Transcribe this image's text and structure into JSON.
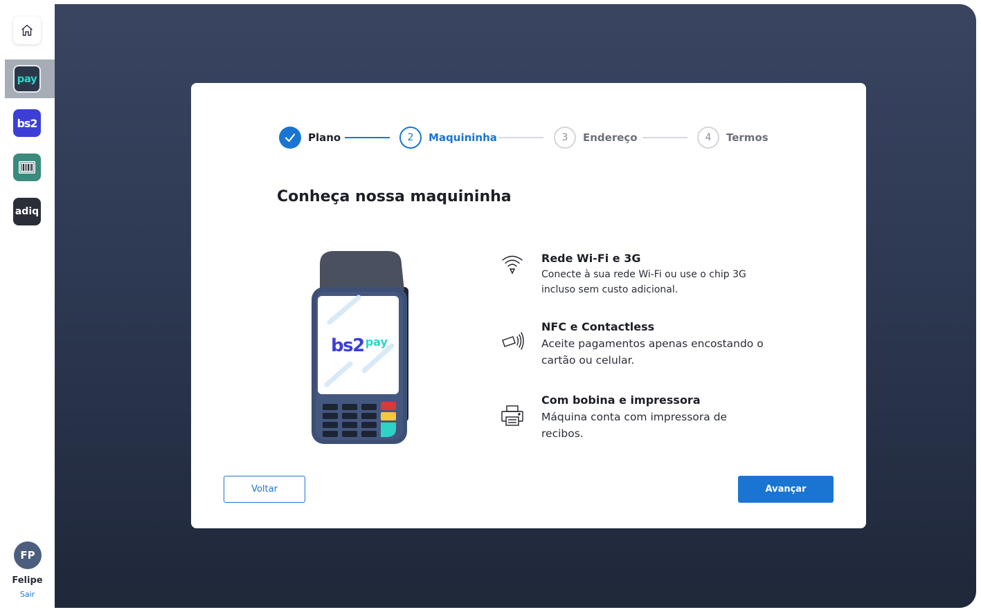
{
  "sidebar": {
    "apps": [
      {
        "name": "home",
        "icon": "home-icon"
      },
      {
        "name": "pay",
        "label": "pay"
      },
      {
        "name": "bs2",
        "label": "bs2"
      },
      {
        "name": "barcode",
        "icon": "barcode-icon"
      },
      {
        "name": "adiq",
        "label": "adiq"
      }
    ],
    "user": {
      "initials": "FP",
      "name": "Felipe",
      "logout": "Sair"
    }
  },
  "stepper": {
    "steps": [
      {
        "number": "1",
        "label": "Plano",
        "state": "done"
      },
      {
        "number": "2",
        "label": "Maquininha",
        "state": "active"
      },
      {
        "number": "3",
        "label": "Endereço",
        "state": "todo"
      },
      {
        "number": "4",
        "label": "Termos",
        "state": "todo"
      }
    ]
  },
  "heading": "Conheça nossa maquininha",
  "device": {
    "brand": "bs2",
    "brand_suffix": "pay"
  },
  "features": [
    {
      "icon": "wifi-icon",
      "title": "Rede Wi-Fi e 3G",
      "description": "Conecte à  sua rede Wi-Fi ou use o chip 3G incluso sem custo adicional."
    },
    {
      "icon": "nfc-icon",
      "title": "NFC e Contactless",
      "description": "Aceite pagamentos apenas encostando o cartão ou celular."
    },
    {
      "icon": "printer-icon",
      "title": "Com bobina e impressora",
      "description": "Máquina conta com impressora de recibos."
    }
  ],
  "actions": {
    "back": "Voltar",
    "next": "Avançar"
  },
  "colors": {
    "primary": "#1a75d2",
    "panel": "#2c3750",
    "pay_accent": "#2fd3c6",
    "bs2_brand": "#3c3fd6"
  }
}
